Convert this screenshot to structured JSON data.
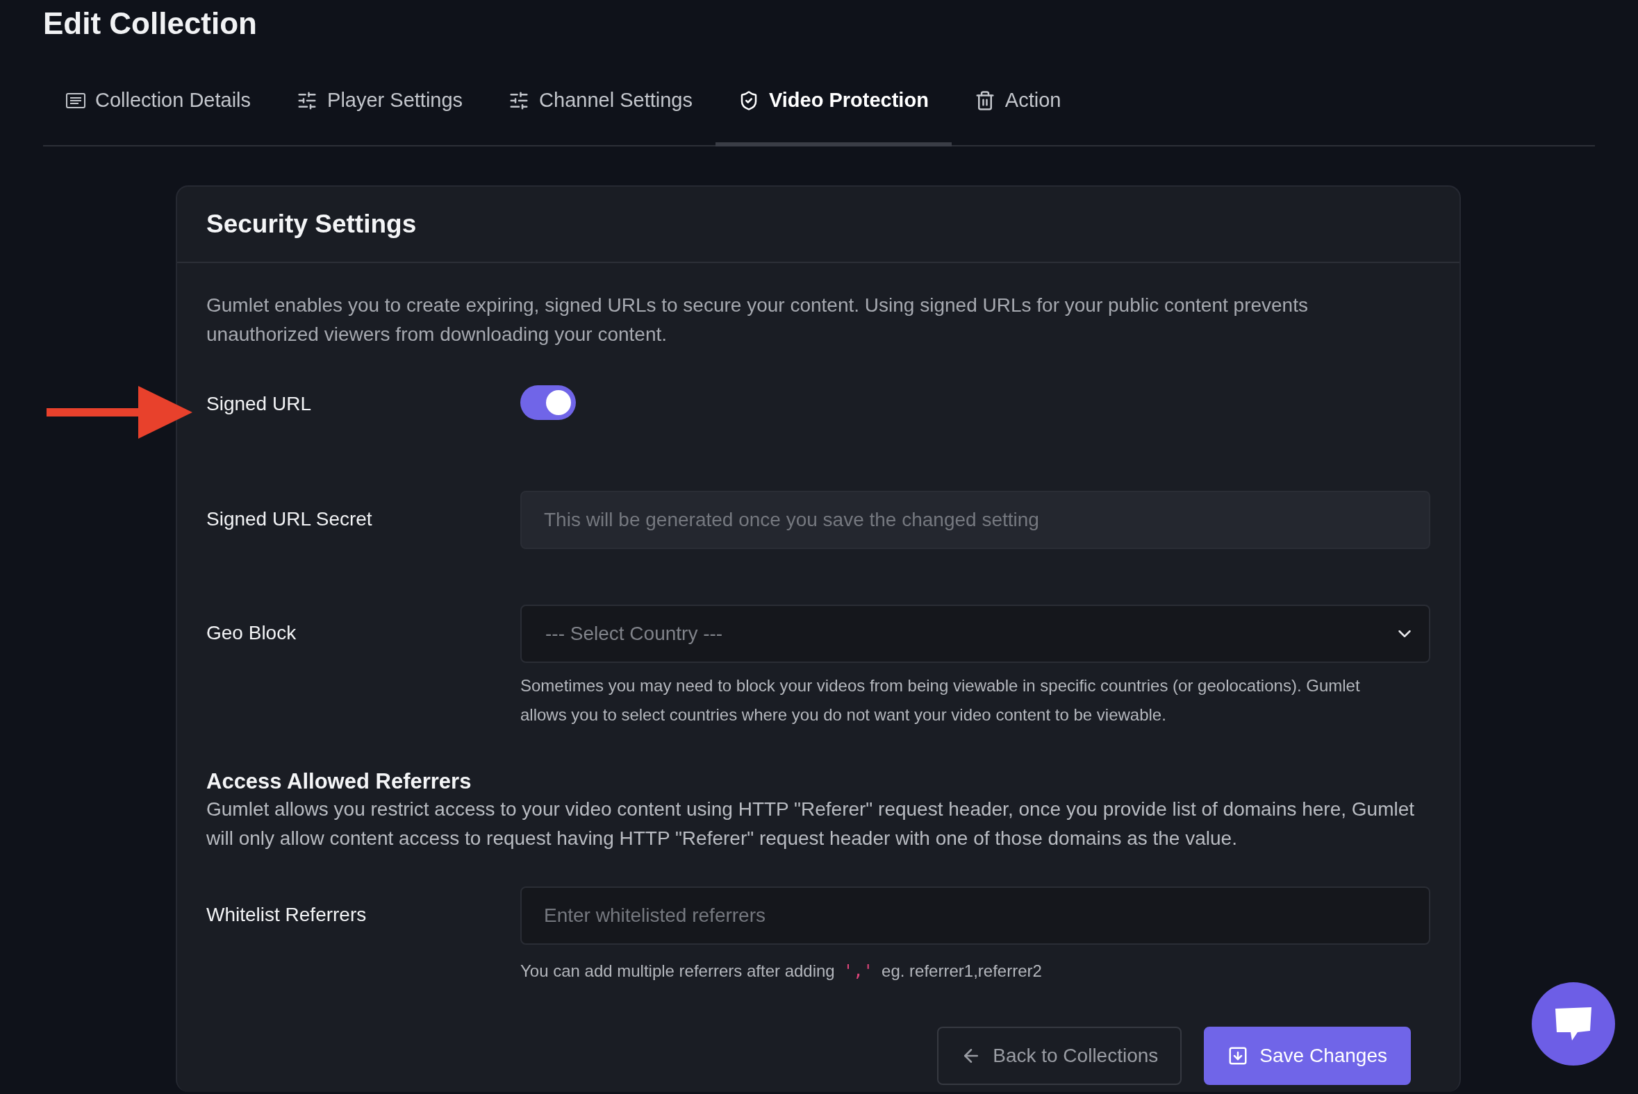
{
  "page": {
    "title": "Edit Collection"
  },
  "tabs": [
    {
      "label": "Collection Details",
      "kind": "details",
      "selected": false
    },
    {
      "label": "Player Settings",
      "kind": "settings",
      "selected": false
    },
    {
      "label": "Channel Settings",
      "kind": "settings",
      "selected": false
    },
    {
      "label": "Video Protection",
      "kind": "protection",
      "selected": true
    },
    {
      "label": "Action",
      "kind": "action",
      "selected": false
    }
  ],
  "security": {
    "title": "Security Settings",
    "description": "Gumlet enables you to create expiring, signed URLs to secure your content. Using signed URLs for your public content prevents unauthorized viewers from downloading your content.",
    "fields": [
      {
        "kind": "toggle",
        "label": "Signed URL",
        "on": true,
        "highlighted": true
      },
      {
        "kind": "input",
        "label": "Signed URL Secret",
        "placeholder": "This will be generated once you save the changed setting",
        "disabled": true
      },
      {
        "kind": "select",
        "label": "Geo Block",
        "placeholder": "--- Select Country ---",
        "help": "Sometimes you may need to block your videos from being viewable in specific countries (or geolocations). Gumlet allows you to select countries where you do not want your video content to be viewable."
      }
    ]
  },
  "referrers": {
    "title": "Access Allowed Referrers",
    "description": "Gumlet allows you restrict access to your video content using HTTP \"Referer\" request header, once you provide list of domains here, Gumlet will only allow content access to request having HTTP \"Referer\" request header with one of those domains as the value.",
    "fields": [
      {
        "kind": "input",
        "label": "Whitelist Referrers",
        "placeholder": "Enter whitelisted referrers",
        "disabled": false,
        "help_parts": [
          "You can add multiple referrers after adding",
          "','",
          "eg. referrer1,referrer2"
        ]
      }
    ]
  },
  "buttons": [
    {
      "label": "Back to Collections",
      "kind": "secondary"
    },
    {
      "label": "Save Changes",
      "kind": "primary"
    }
  ]
}
